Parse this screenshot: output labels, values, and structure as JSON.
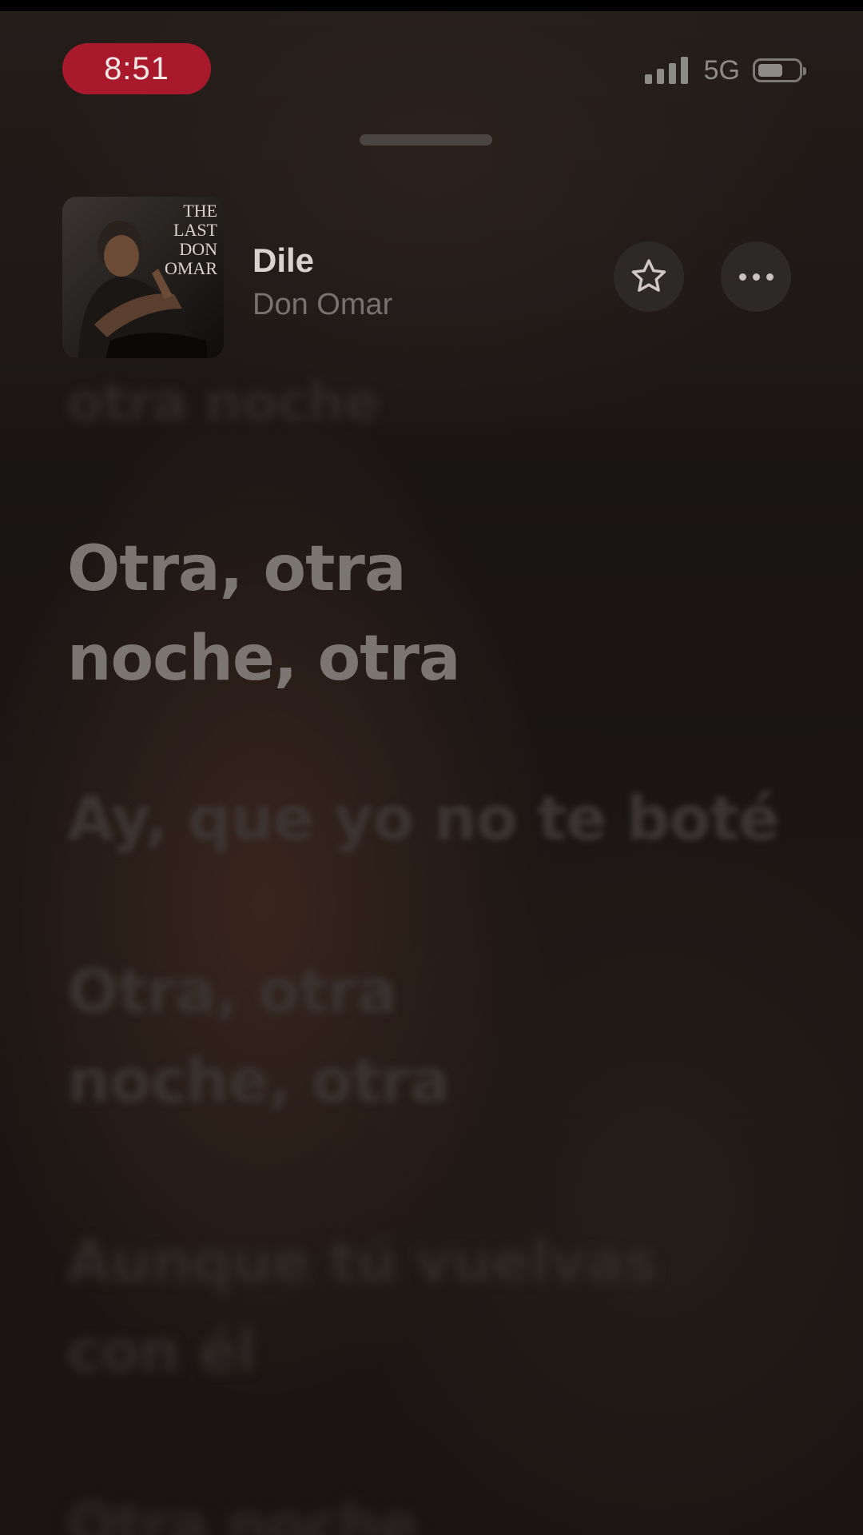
{
  "status_bar": {
    "time": "8:51",
    "network": "5G",
    "signal_icon": "cellular-signal-icon",
    "battery_icon": "battery-icon",
    "battery_level": 0.5,
    "time_pill_color": "#a8192c"
  },
  "now_playing": {
    "artwork_icon": "album-artwork",
    "artwork_text": "THE LAST DON OMAR",
    "title": "Dile",
    "artist": "Don Omar",
    "favorite_icon": "star-icon",
    "more_icon": "ellipsis-icon"
  },
  "lyrics": {
    "previous": "otra noche",
    "current": "Otra, otra noche, otra",
    "upcoming": [
      "Ay, que yo no te boté",
      "Otra, otra noche, otra",
      "Aunque tú vuelvas con él",
      "Otra noche"
    ]
  }
}
